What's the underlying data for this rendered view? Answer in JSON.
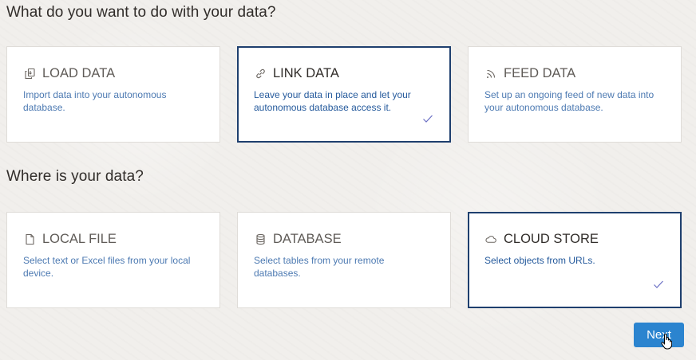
{
  "questions": {
    "action": "What do you want to do with your data?",
    "source": "Where is your data?"
  },
  "action_cards": [
    {
      "title": "LOAD DATA",
      "description": "Import data into your autonomous database.",
      "icon": "load-data-icon",
      "selected": false
    },
    {
      "title": "LINK DATA",
      "description": "Leave your data in place and let your autonomous database access it.",
      "icon": "link-icon",
      "selected": true
    },
    {
      "title": "FEED DATA",
      "description": "Set up an ongoing feed of new data into your autonomous database.",
      "icon": "feed-icon",
      "selected": false
    }
  ],
  "source_cards": [
    {
      "title": "LOCAL FILE",
      "description": "Select text or Excel files from your local device.",
      "icon": "file-icon",
      "selected": false
    },
    {
      "title": "DATABASE",
      "description": "Select tables from your remote databases.",
      "icon": "database-icon",
      "selected": false
    },
    {
      "title": "CLOUD STORE",
      "description": "Select objects from URLs.",
      "icon": "cloud-icon",
      "selected": true
    }
  ],
  "next_button": {
    "label": "Next"
  },
  "colors": {
    "selected_border": "#1e3f6e",
    "description_text": "#255a9c",
    "button": "#2b84cf",
    "check": "#6a6fc4"
  }
}
